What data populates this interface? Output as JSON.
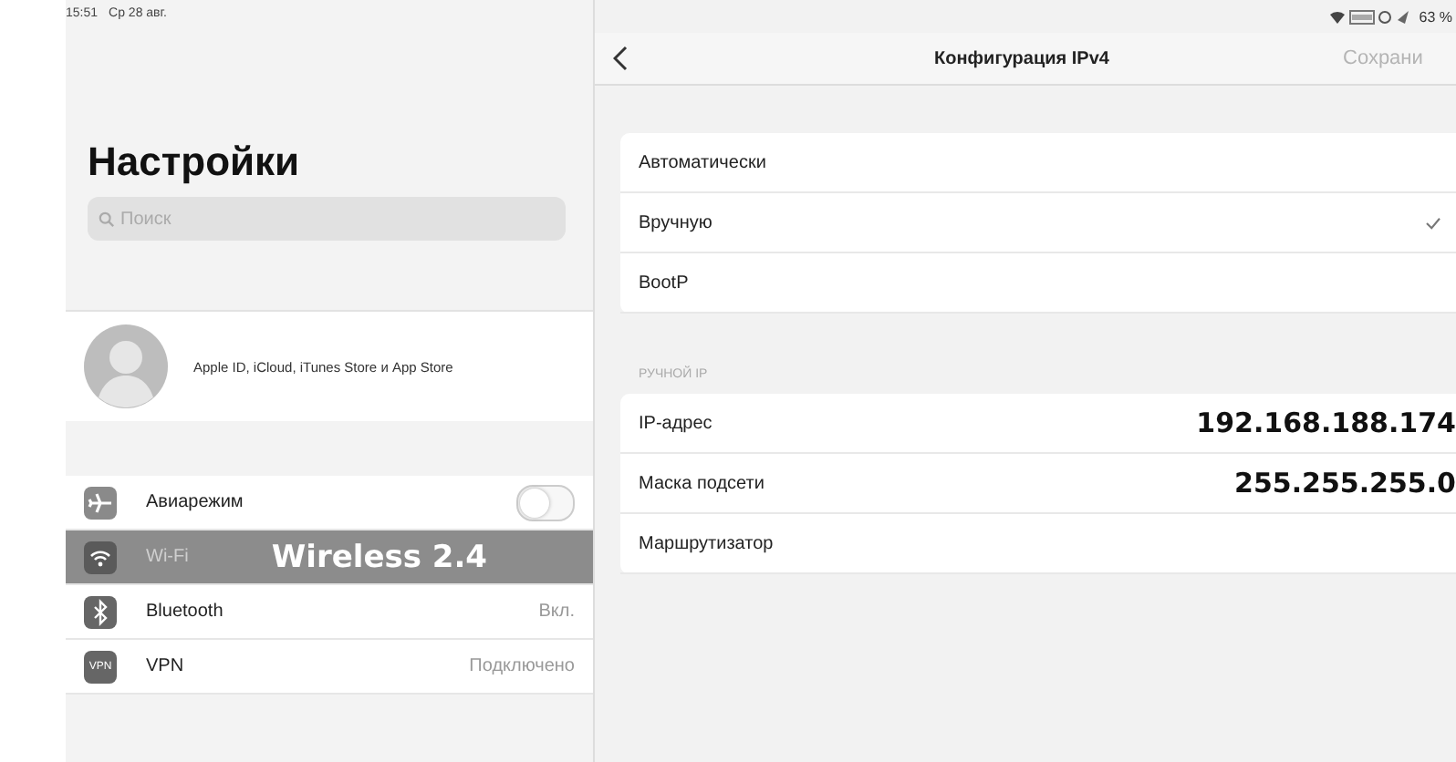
{
  "status_bar": {
    "time": "15:51",
    "date": "Ср 28 авг.",
    "battery": "63 %"
  },
  "sidebar": {
    "title": "Настройки",
    "search": {
      "placeholder": "Поиск"
    },
    "profile": {
      "label": "Apple ID, iCloud, iTunes Store и App Store"
    },
    "items": [
      {
        "kind": "toggle",
        "label": "Авиарежим",
        "on": false,
        "selected": false
      },
      {
        "kind": "value",
        "label": "Wi-Fi",
        "value": "Wireless 2.4",
        "selected": true
      },
      {
        "kind": "value",
        "label": "Bluetooth",
        "value": "Вкл.",
        "selected": false
      },
      {
        "kind": "value",
        "badge": "VPN",
        "label": "VPN",
        "value": "Подключено",
        "selected": false
      }
    ]
  },
  "detail": {
    "title": "Конфигурация IPv4",
    "action": {
      "label": "Сохрани",
      "disabled": true
    },
    "methods": [
      {
        "label": "Автоматически",
        "selected": false
      },
      {
        "label": "Вручную",
        "selected": true
      },
      {
        "label": "BootP",
        "selected": false
      }
    ],
    "manual": {
      "header": "РУЧНОЙ IP",
      "fields": [
        {
          "label": "IP-адрес",
          "value": "192.168.188.174"
        },
        {
          "label": "Маска подсети",
          "value": "255.255.255.0"
        },
        {
          "label": "Маршрутизатор"
        }
      ]
    }
  }
}
